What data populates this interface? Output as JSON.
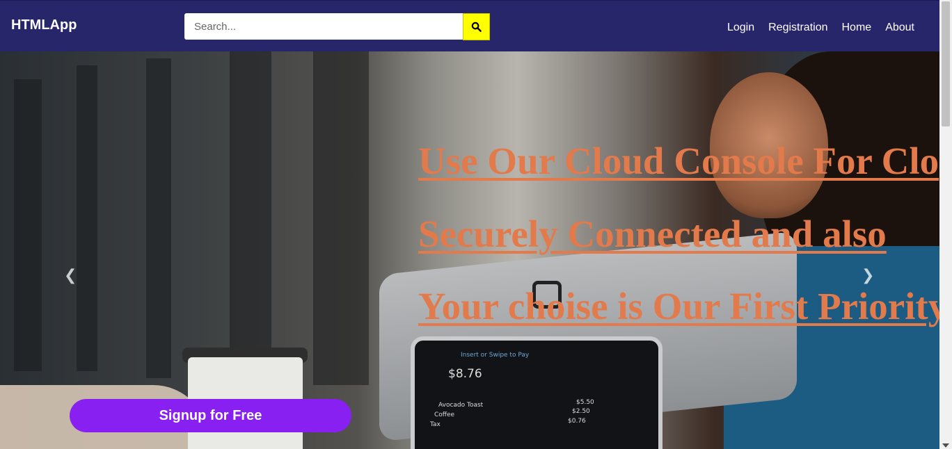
{
  "navbar": {
    "brand": "HTMLApp",
    "search": {
      "placeholder": "Search...",
      "value": ""
    },
    "search_button_icon": "search-icon",
    "links": [
      "Login",
      "Registration",
      "Home",
      "About"
    ],
    "background_color": "#28266a",
    "search_button_color": "#ffff00"
  },
  "hero": {
    "headlines": [
      "Use Our Cloud Console For Clo",
      "Securely Connected and also",
      "Your choise is Our First Priority"
    ],
    "headline_color": "#e27a4b",
    "pos_screen": {
      "prompt": "Insert or Swipe to Pay",
      "total": "$8.76",
      "items": [
        {
          "name": "Avocado Toast",
          "price": "$5.50"
        },
        {
          "name": "Coffee",
          "price": "$2.50"
        },
        {
          "name": "Tax",
          "price": "$0.76"
        }
      ]
    },
    "prev_icon": "chevron-left-icon",
    "next_icon": "chevron-right-icon",
    "signup_label": "Signup for Free",
    "signup_color": "#8820f2"
  }
}
